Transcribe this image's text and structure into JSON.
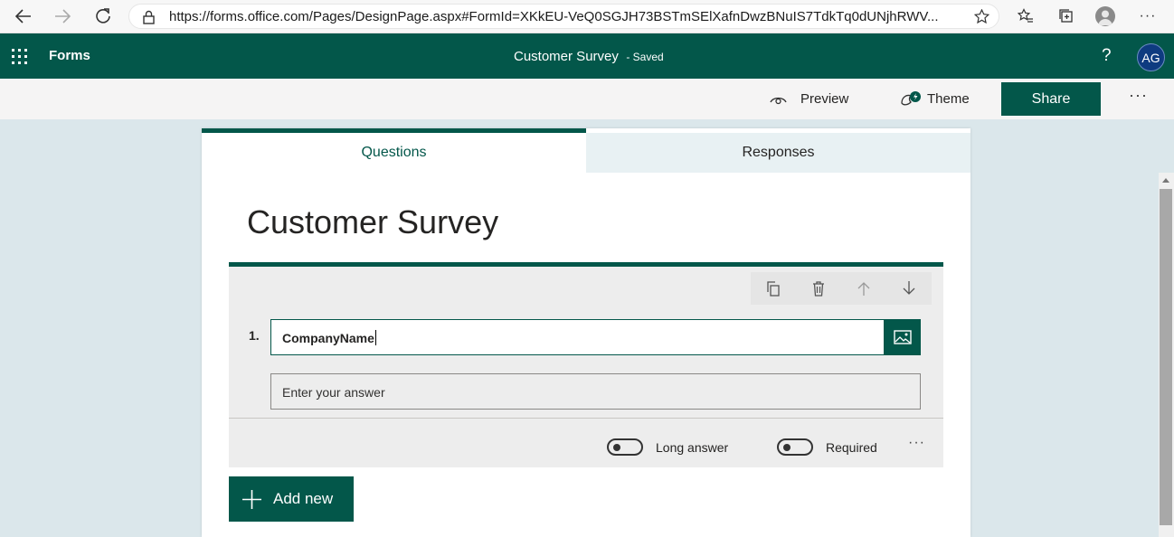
{
  "browser": {
    "url": "https://forms.office.com/Pages/DesignPage.aspx#FormId=XKkEU-VeQ0SGJH73BSTmSElXafnDwzBNuIS7TdkTq0dUNjhRWV..."
  },
  "app": {
    "name": "Forms",
    "form_title": "Customer Survey",
    "save_status": "- Saved",
    "help": "?",
    "user_initials": "AG"
  },
  "toolbar": {
    "preview_label": "Preview",
    "theme_label": "Theme",
    "share_label": "Share",
    "more": "···"
  },
  "tabs": [
    {
      "label": "Questions",
      "active": true
    },
    {
      "label": "Responses",
      "active": false
    }
  ],
  "form": {
    "title": "Customer Survey",
    "questions": [
      {
        "number": "1.",
        "text": "CompanyName",
        "answer_placeholder": "Enter your answer",
        "long_answer_label": "Long answer",
        "required_label": "Required",
        "more": "···"
      }
    ],
    "add_new_label": "Add new"
  },
  "colors": {
    "accent": "#03574a",
    "background": "#dbe7eb",
    "avatar": "#0e3b80"
  }
}
